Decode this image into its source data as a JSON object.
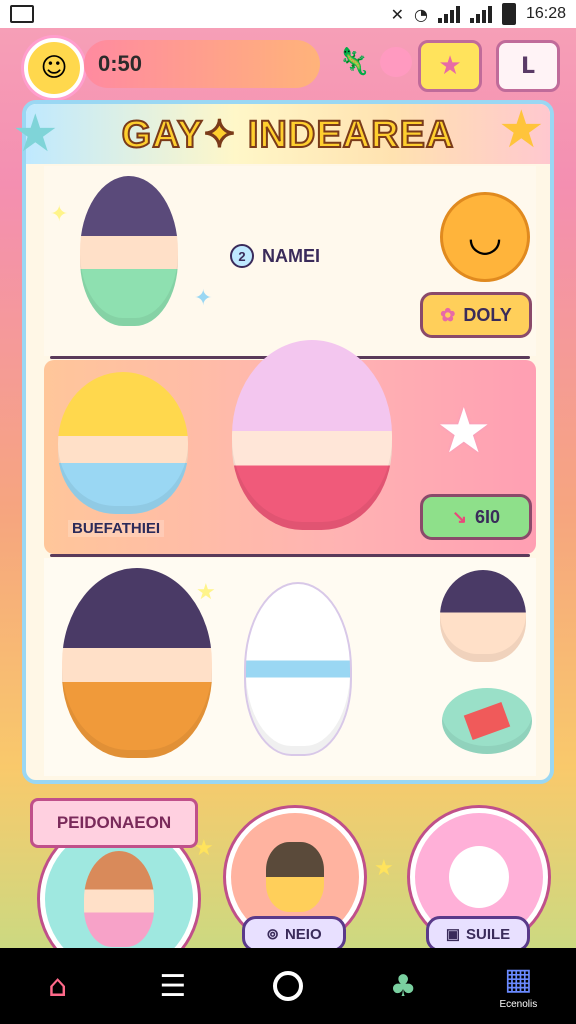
{
  "status_bar": {
    "time": "16:28"
  },
  "top_bar": {
    "timer": "0:50",
    "flower_icon": "happy-flower-icon",
    "star_button": "star-icon",
    "profile_button": "profile-icon"
  },
  "panel": {
    "title": "GAY✦ INDEAREA",
    "rows": [
      {
        "name_number": "2",
        "name": "NAMEI",
        "button_label": "DOLY",
        "button_color": "#ffcf5a"
      },
      {
        "character_label": "BUEFATHIEI",
        "button_label": "6I0",
        "button_color": "#8ee08a"
      },
      {}
    ]
  },
  "bottom": {
    "ribbon_label": "PEIDONAEON",
    "circles": [
      {
        "label": ""
      },
      {
        "label": "NEIO"
      },
      {
        "label": "SUILE"
      }
    ]
  },
  "nav": {
    "items": [
      {
        "icon": "home-icon",
        "label": ""
      },
      {
        "icon": "list-icon",
        "label": ""
      },
      {
        "icon": "circle-icon",
        "label": ""
      },
      {
        "icon": "character-icon",
        "label": ""
      },
      {
        "icon": "game-controller-icon",
        "label": "Ecenolis"
      }
    ]
  }
}
